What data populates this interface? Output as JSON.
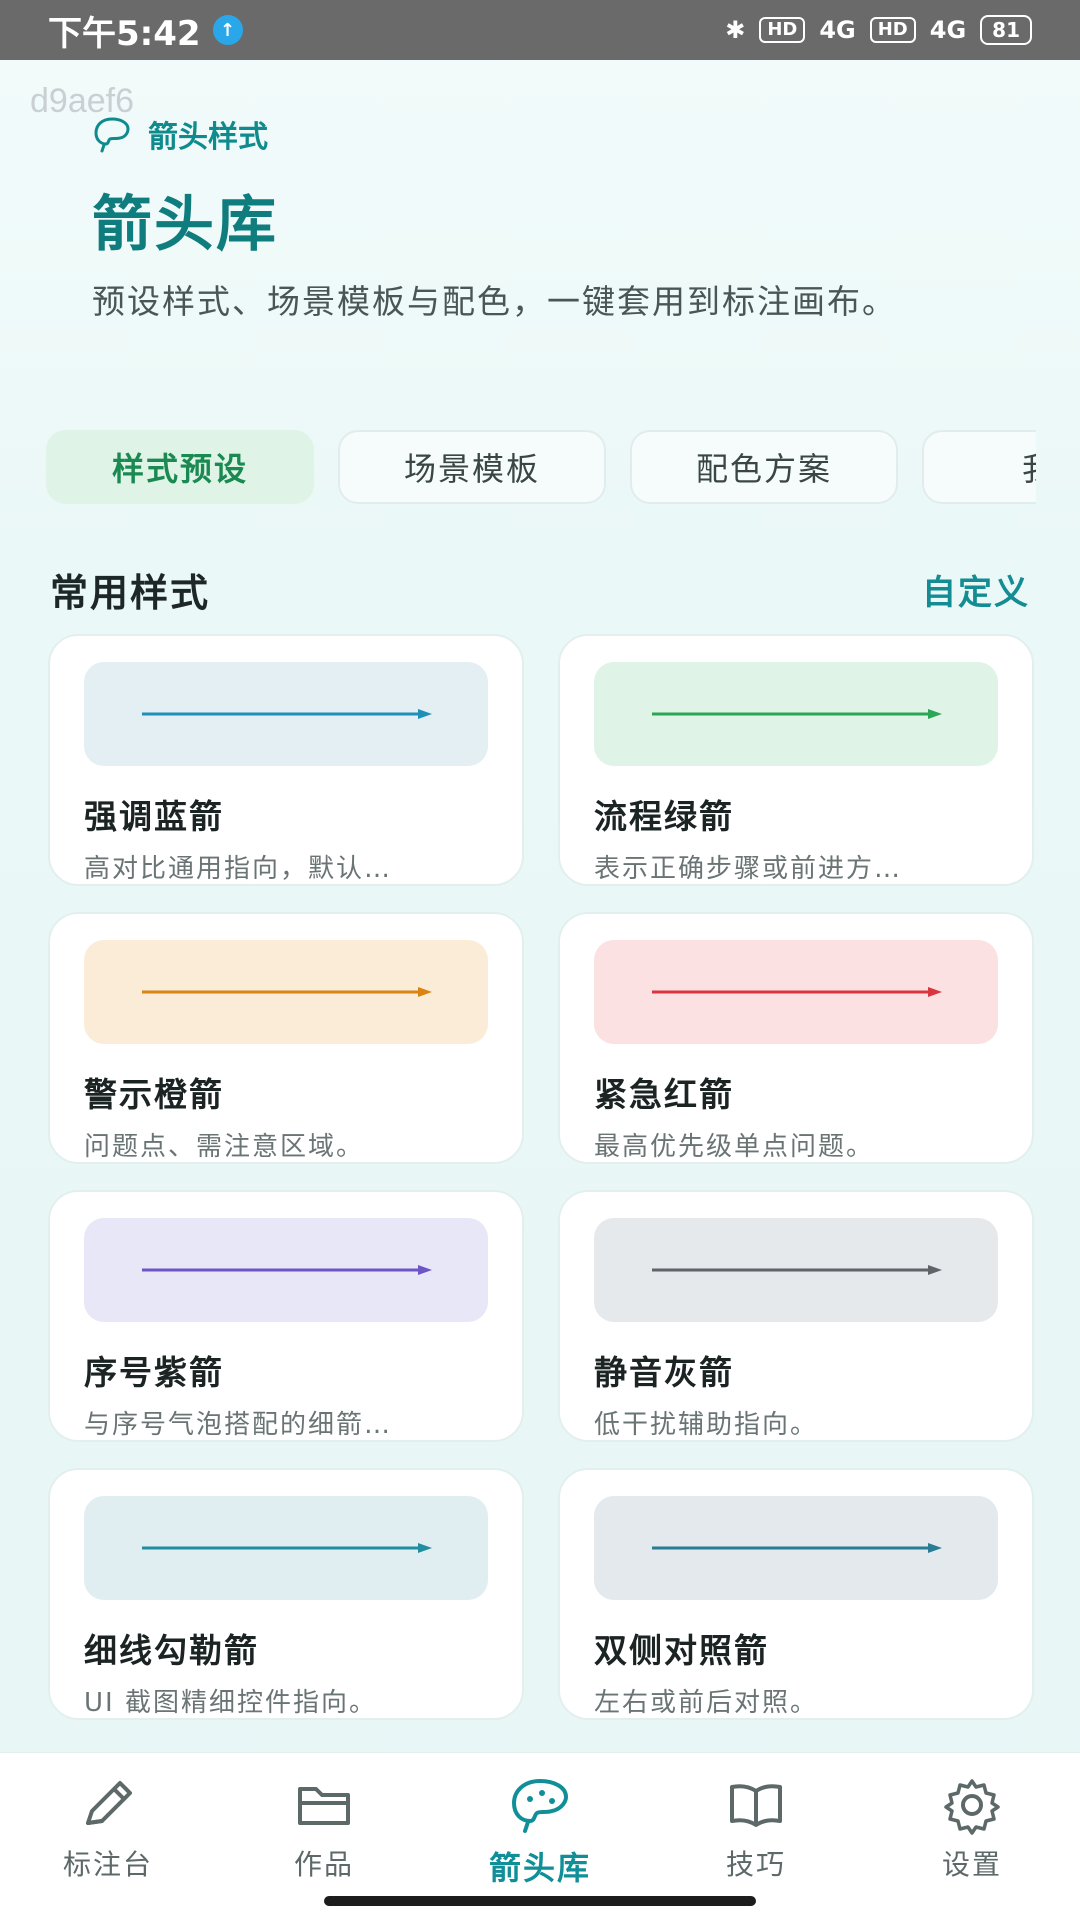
{
  "status_bar": {
    "time": "下午5:42",
    "bluetooth": "✱",
    "sim1": "HD",
    "net1": "4G",
    "sim2": "HD",
    "net2": "4G",
    "battery": "81"
  },
  "debug_tag": "d9aef6",
  "header": {
    "kicker": "箭头样式",
    "title": "箭头库",
    "description": "预设样式、场景模板与配色，一键套用到标注画布。"
  },
  "tabs": [
    {
      "label": "样式预设",
      "active": true
    },
    {
      "label": "场景模板",
      "active": false
    },
    {
      "label": "配色方案",
      "active": false
    },
    {
      "label": "我的",
      "active": false
    }
  ],
  "section": {
    "title": "常用样式",
    "action": "自定义"
  },
  "cards": [
    {
      "title": "强调蓝箭",
      "desc": "高对比通用指向，默认…",
      "bg": "#e3eff3",
      "color": "#1e90b8"
    },
    {
      "title": "流程绿箭",
      "desc": "表示正确步骤或前进方…",
      "bg": "#dff4e6",
      "color": "#2aa656"
    },
    {
      "title": "警示橙箭",
      "desc": "问题点、需注意区域。",
      "bg": "#fbecd8",
      "color": "#d98312"
    },
    {
      "title": "紧急红箭",
      "desc": "最高优先级单点问题。",
      "bg": "#fbe1e2",
      "color": "#d9343f"
    },
    {
      "title": "序号紫箭",
      "desc": "与序号气泡搭配的细箭…",
      "bg": "#e7e7f8",
      "color": "#6e54c6"
    },
    {
      "title": "静音灰箭",
      "desc": "低干扰辅助指向。",
      "bg": "#e6e9eb",
      "color": "#5e6468"
    },
    {
      "title": "细线勾勒箭",
      "desc": "UI 截图精细控件指向。",
      "bg": "#e1eef1",
      "color": "#1f8ea0"
    },
    {
      "title": "双侧对照箭",
      "desc": "左右或前后对照。",
      "bg": "#e3e9ec",
      "color": "#2a7c95"
    }
  ],
  "nav": [
    {
      "label": "标注台",
      "icon": "pencil-icon",
      "active": false
    },
    {
      "label": "作品",
      "icon": "folder-icon",
      "active": false
    },
    {
      "label": "箭头库",
      "icon": "palette-icon",
      "active": true
    },
    {
      "label": "技巧",
      "icon": "book-icon",
      "active": false
    },
    {
      "label": "设置",
      "icon": "gear-icon",
      "active": false
    }
  ],
  "colors": {
    "accent": "#0f8b8d",
    "active_tab_bg": "#dff3e7",
    "active_tab_text": "#1a8a52"
  }
}
